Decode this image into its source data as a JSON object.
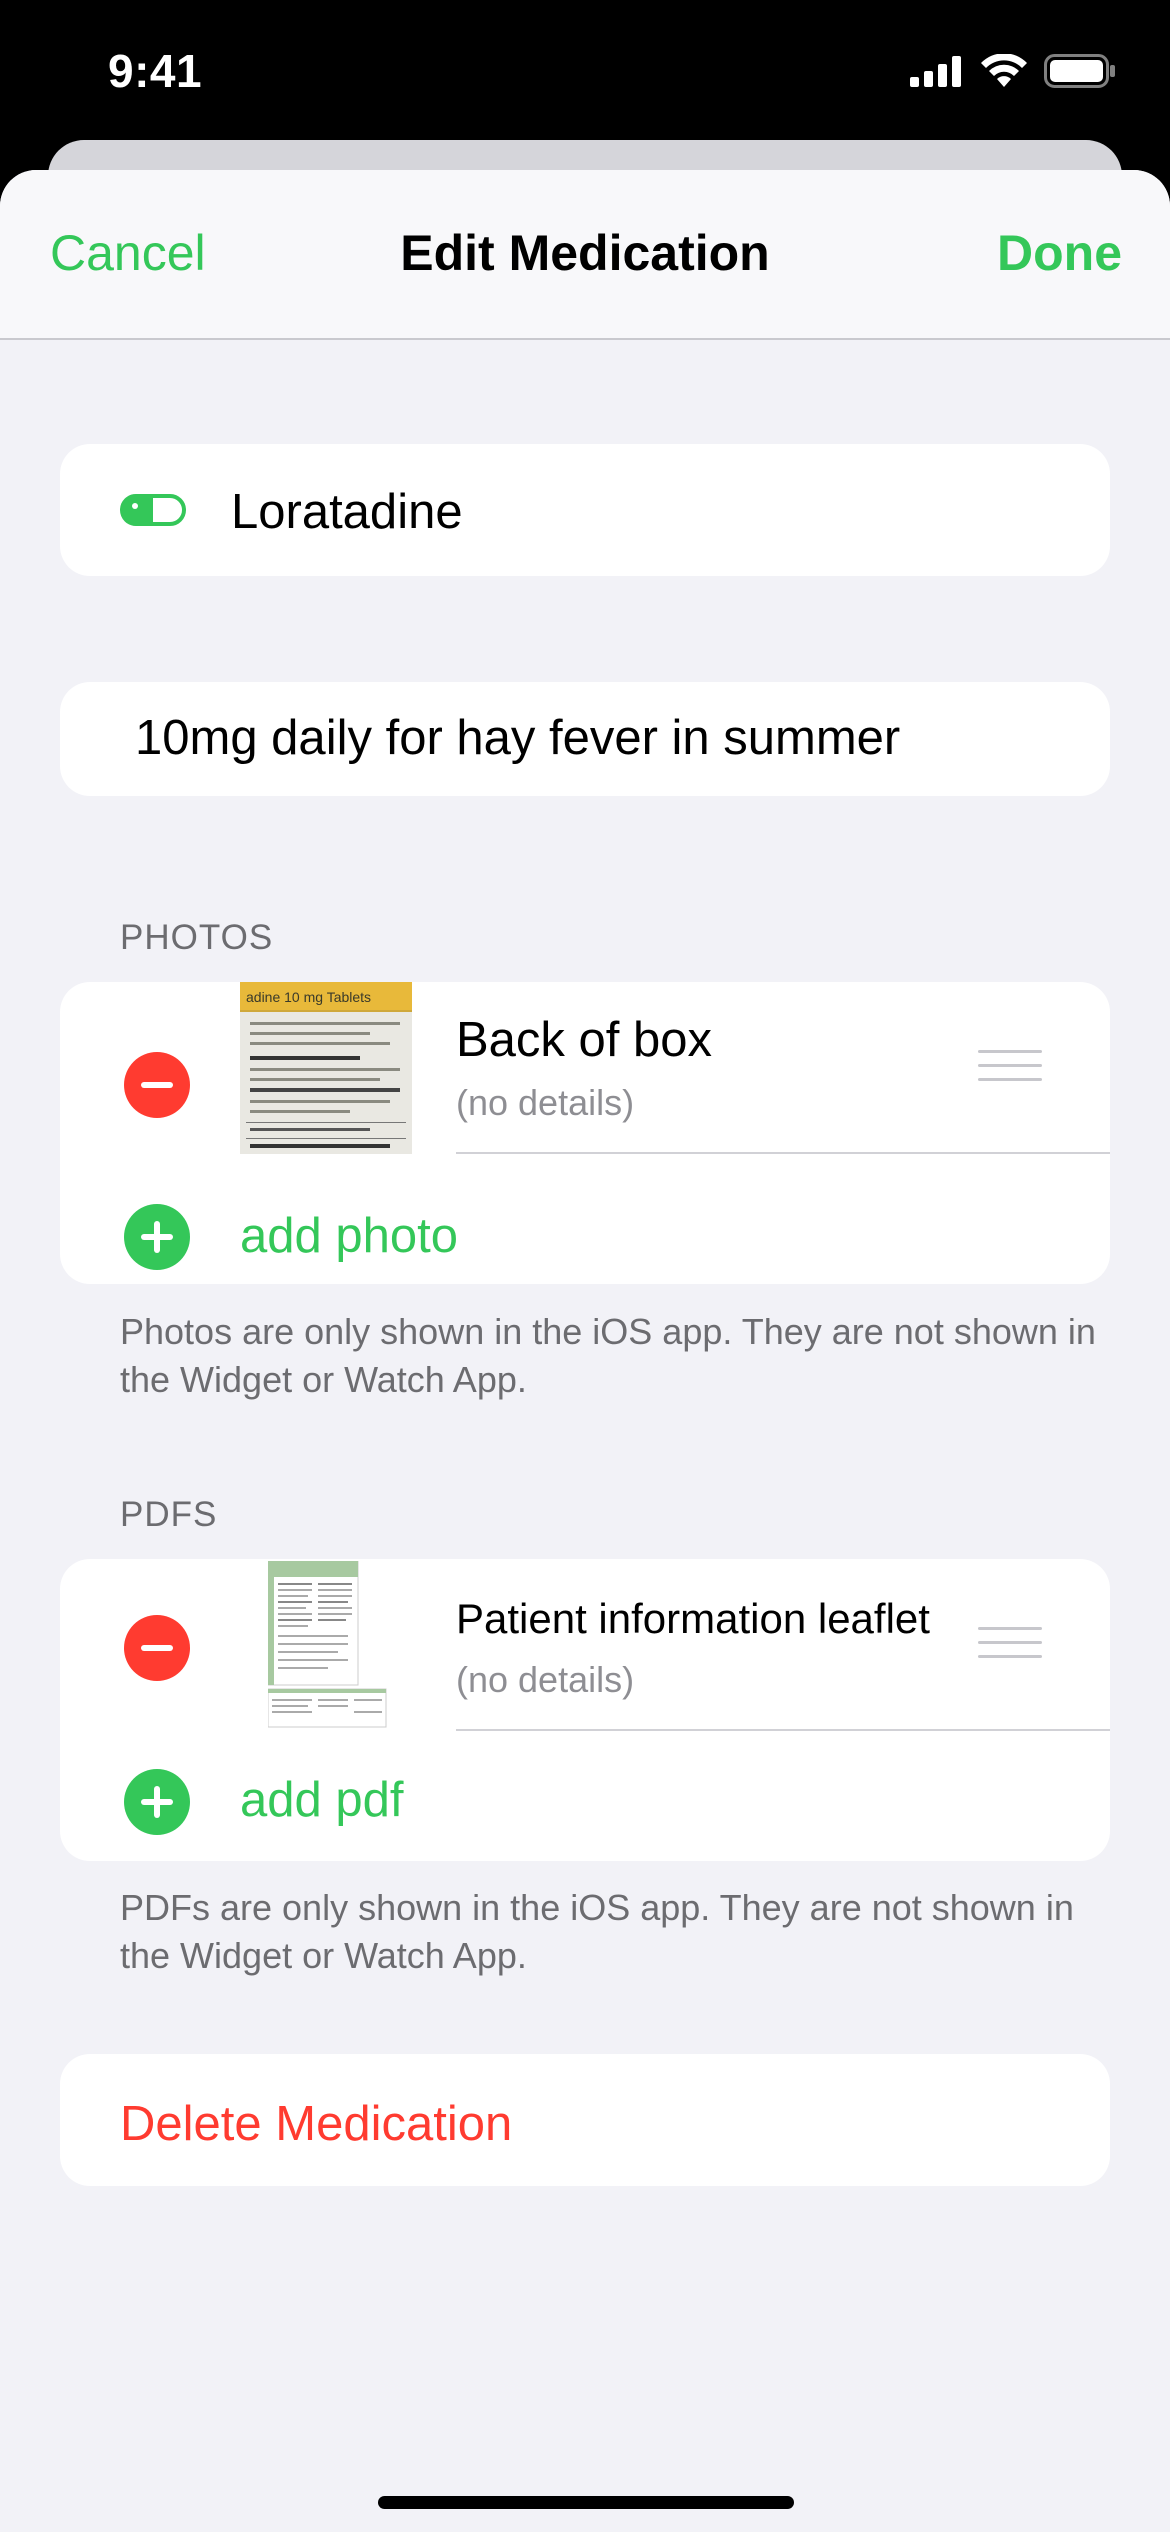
{
  "status_bar": {
    "time": "9:41"
  },
  "nav": {
    "cancel": "Cancel",
    "title": "Edit Medication",
    "done": "Done"
  },
  "medication": {
    "name": "Loratadine",
    "notes": "10mg daily for hay fever in summer",
    "icon": "pill-icon"
  },
  "photos": {
    "header": "PHOTOS",
    "items": [
      {
        "title": "Back of box",
        "details": "(no details)"
      }
    ],
    "add_label": "add photo",
    "footer": "Photos are only shown in the iOS app. They are not shown in the Widget or Watch App.",
    "thumb_text": "adine 10 mg Tablets"
  },
  "pdfs": {
    "header": "PDFS",
    "items": [
      {
        "title": "Patient information leaflet",
        "details": "(no details)"
      }
    ],
    "add_label": "add pdf",
    "footer": "PDFs are only shown in the iOS app. They are not shown in the Widget or Watch App."
  },
  "delete": {
    "label": "Delete Medication"
  },
  "colors": {
    "accent": "#34c759",
    "destructive": "#ff3b30",
    "background": "#f2f2f7"
  }
}
